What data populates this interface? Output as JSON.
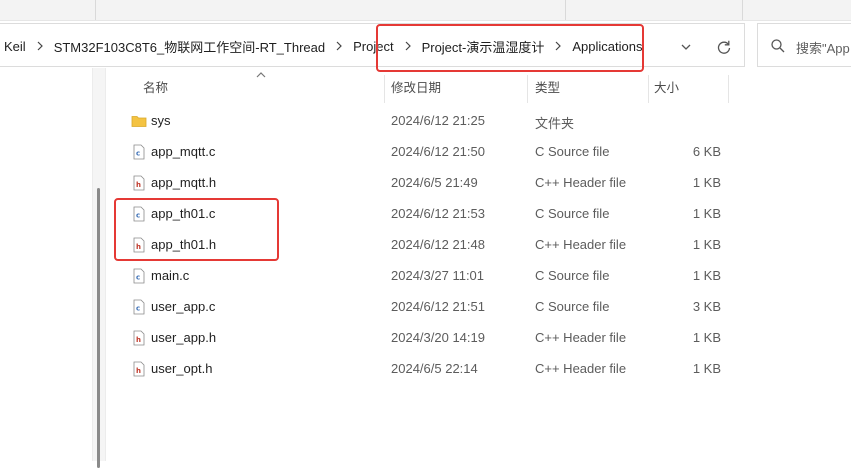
{
  "breadcrumb": {
    "items": [
      "Keil",
      "STM32F103C8T6_物联网工作空间-RT_Thread",
      "Project",
      "Project-演示温湿度计",
      "Applications"
    ]
  },
  "search": {
    "placeholder": "搜索\"App"
  },
  "columns": {
    "name": "名称",
    "date": "修改日期",
    "type": "类型",
    "size": "大小"
  },
  "files": [
    {
      "name": "sys",
      "date": "2024/6/12 21:25",
      "type": "文件夹",
      "size": "",
      "icon": "folder-icon"
    },
    {
      "name": "app_mqtt.c",
      "date": "2024/6/12 21:50",
      "type": "C Source file",
      "size": "6 KB",
      "icon": "c-source-icon"
    },
    {
      "name": "app_mqtt.h",
      "date": "2024/6/5 21:49",
      "type": "C++ Header file",
      "size": "1 KB",
      "icon": "header-file-icon"
    },
    {
      "name": "app_th01.c",
      "date": "2024/6/12 21:53",
      "type": "C Source file",
      "size": "1 KB",
      "icon": "c-source-icon"
    },
    {
      "name": "app_th01.h",
      "date": "2024/6/12 21:48",
      "type": "C++ Header file",
      "size": "1 KB",
      "icon": "header-file-icon"
    },
    {
      "name": "main.c",
      "date": "2024/3/27 11:01",
      "type": "C Source file",
      "size": "1 KB",
      "icon": "c-source-icon"
    },
    {
      "name": "user_app.c",
      "date": "2024/6/12 21:51",
      "type": "C Source file",
      "size": "3 KB",
      "icon": "c-source-icon"
    },
    {
      "name": "user_app.h",
      "date": "2024/3/20 14:19",
      "type": "C++ Header file",
      "size": "1 KB",
      "icon": "header-file-icon"
    },
    {
      "name": "user_opt.h",
      "date": "2024/6/5 22:14",
      "type": "C++ Header file",
      "size": "1 KB",
      "icon": "header-file-icon"
    }
  ],
  "colors": {
    "annotation": "#e53935",
    "folder": "#f4c342",
    "c_icon": "#3b6fb6",
    "h_icon": "#c0392b"
  }
}
